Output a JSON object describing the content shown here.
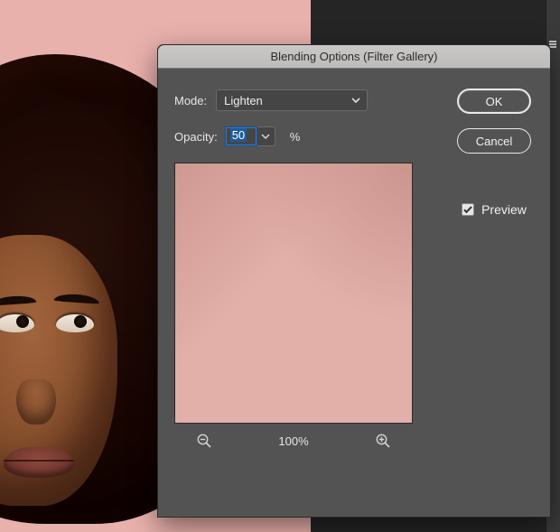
{
  "dialog": {
    "title": "Blending Options (Filter Gallery)",
    "mode_label": "Mode:",
    "mode_value": "Lighten",
    "opacity_label": "Opacity:",
    "opacity_value": "50",
    "opacity_unit": "%",
    "zoom_level": "100%",
    "ok_label": "OK",
    "cancel_label": "Cancel",
    "preview_label": "Preview",
    "preview_checked": true
  },
  "colors": {
    "canvas_bg": "#e9b1ac",
    "dialog_bg": "#535353",
    "focus_ring": "#2b7bd1"
  }
}
